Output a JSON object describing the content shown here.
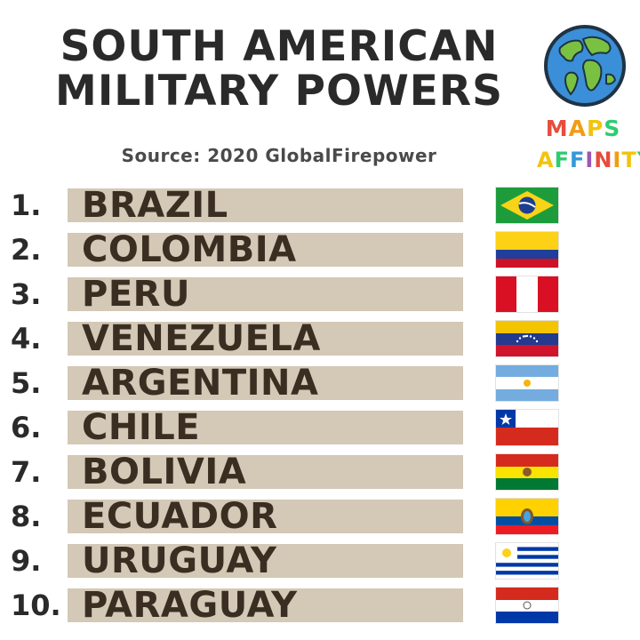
{
  "header": {
    "title_line1": "SOUTH AMERICAN",
    "title_line2": "MILITARY POWERS",
    "subtitle": "Source: 2020 GlobalFirepower"
  },
  "logo": {
    "line1": "MAPS",
    "line2": "AFFINITY",
    "icon": "globe-icon",
    "colors": [
      "#e74c3c",
      "#f39c12",
      "#f1c40f",
      "#2ecc71",
      "#3498db",
      "#9b59b6"
    ]
  },
  "ranking": [
    {
      "rank": "1.",
      "country": "BRAZIL",
      "flag": "brazil-flag-icon"
    },
    {
      "rank": "2.",
      "country": "COLOMBIA",
      "flag": "colombia-flag-icon"
    },
    {
      "rank": "3.",
      "country": "PERU",
      "flag": "peru-flag-icon"
    },
    {
      "rank": "4.",
      "country": "VENEZUELA",
      "flag": "venezuela-flag-icon"
    },
    {
      "rank": "5.",
      "country": "ARGENTINA",
      "flag": "argentina-flag-icon"
    },
    {
      "rank": "6.",
      "country": "CHILE",
      "flag": "chile-flag-icon"
    },
    {
      "rank": "7.",
      "country": "BOLIVIA",
      "flag": "bolivia-flag-icon"
    },
    {
      "rank": "8.",
      "country": "ECUADOR",
      "flag": "ecuador-flag-icon"
    },
    {
      "rank": "9.",
      "country": "URUGUAY",
      "flag": "uruguay-flag-icon"
    },
    {
      "rank": "10.",
      "country": "PARAGUAY",
      "flag": "paraguay-flag-icon"
    }
  ],
  "colors": {
    "bar": "#d4c8b6",
    "text": "#3a2e22",
    "title": "#2a2a2a"
  }
}
